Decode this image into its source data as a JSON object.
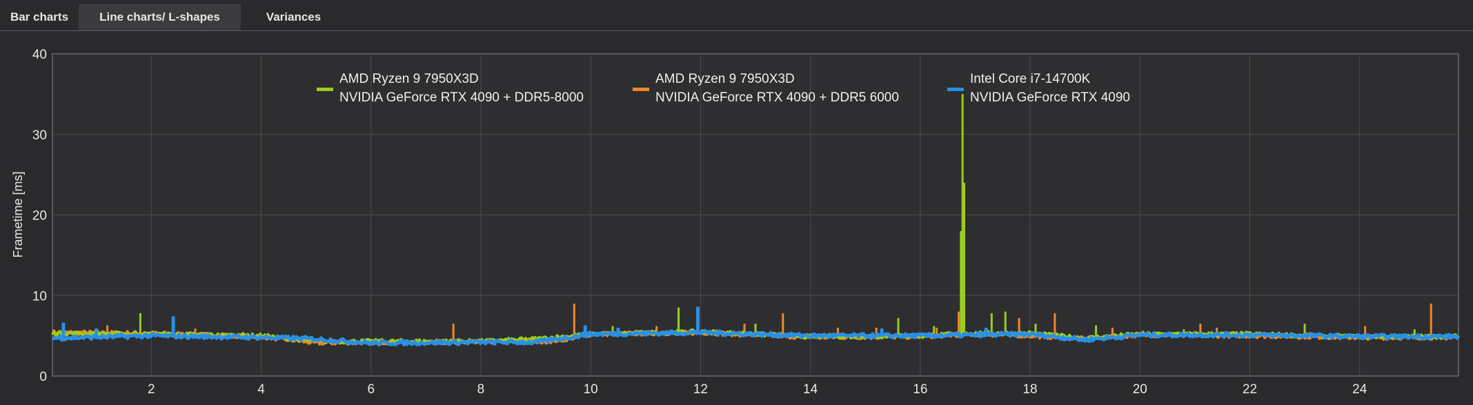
{
  "tabs": [
    {
      "label": "Bar charts"
    },
    {
      "label": "Line charts/ L-shapes"
    },
    {
      "label": "Variances"
    }
  ],
  "chart_data": {
    "type": "line",
    "title": "",
    "xlabel": "",
    "ylabel": "Frametime [ms]",
    "xlim": [
      0.2,
      25.8
    ],
    "ylim": [
      0,
      40
    ],
    "x_ticks": [
      2,
      4,
      6,
      8,
      10,
      12,
      14,
      16,
      18,
      20,
      22,
      24
    ],
    "y_ticks": [
      0,
      10,
      20,
      30,
      40
    ],
    "grid": true,
    "legend_position": "top",
    "series": [
      {
        "name_line1": "AMD Ryzen 9 7950X3D",
        "name_line2": "NVIDIA GeForce RTX 4090 + DDR5-8000",
        "color": "#9acd1e",
        "baseline": [
          [
            0.2,
            5.3
          ],
          [
            2,
            5.2
          ],
          [
            4,
            5.0
          ],
          [
            5,
            4.3
          ],
          [
            6,
            4.3
          ],
          [
            8,
            4.3
          ],
          [
            9,
            4.6
          ],
          [
            10,
            5.2
          ],
          [
            12,
            5.5
          ],
          [
            14,
            4.9
          ],
          [
            16,
            5.0
          ],
          [
            17,
            5.3
          ],
          [
            18,
            5.3
          ],
          [
            19,
            4.7
          ],
          [
            20,
            5.2
          ],
          [
            22,
            5.2
          ],
          [
            24,
            4.9
          ],
          [
            25.8,
            4.9
          ]
        ],
        "spikes": [
          [
            1.8,
            7.8
          ],
          [
            10.4,
            6.2
          ],
          [
            11.6,
            8.5
          ],
          [
            13.0,
            6.5
          ],
          [
            15.6,
            7.2
          ],
          [
            16.25,
            6.2
          ],
          [
            16.74,
            18.0
          ],
          [
            16.77,
            35.0
          ],
          [
            16.8,
            24.0
          ],
          [
            17.3,
            7.8
          ],
          [
            17.55,
            8.0
          ],
          [
            18.1,
            6.5
          ],
          [
            19.2,
            6.3
          ],
          [
            20.8,
            5.8
          ],
          [
            23.0,
            6.5
          ],
          [
            25.0,
            5.8
          ]
        ]
      },
      {
        "name_line1": "AMD Ryzen 9 7950X3D",
        "name_line2": "NVIDIA GeForce RTX 4090 + DDR5 6000",
        "color": "#f08828",
        "baseline": [
          [
            0.2,
            5.4
          ],
          [
            2,
            5.3
          ],
          [
            4,
            4.9
          ],
          [
            5,
            4.1
          ],
          [
            6,
            4.2
          ],
          [
            8,
            4.3
          ],
          [
            9,
            4.2
          ],
          [
            9.5,
            4.5
          ],
          [
            10,
            5.2
          ],
          [
            12,
            5.4
          ],
          [
            14,
            4.8
          ],
          [
            16,
            4.9
          ],
          [
            17,
            5.2
          ],
          [
            18,
            5.0
          ],
          [
            19,
            4.6
          ],
          [
            20,
            5.1
          ],
          [
            22,
            5.0
          ],
          [
            24,
            4.8
          ],
          [
            25.8,
            4.8
          ]
        ],
        "spikes": [
          [
            1.2,
            6.3
          ],
          [
            2.8,
            5.9
          ],
          [
            7.5,
            6.5
          ],
          [
            9.7,
            9.0
          ],
          [
            11.2,
            6.2
          ],
          [
            12.8,
            6.5
          ],
          [
            13.5,
            7.8
          ],
          [
            14.5,
            6.0
          ],
          [
            15.2,
            6.0
          ],
          [
            16.3,
            6.0
          ],
          [
            16.7,
            8.0
          ],
          [
            17.8,
            7.2
          ],
          [
            18.45,
            7.8
          ],
          [
            19.5,
            6.0
          ],
          [
            21.1,
            6.5
          ],
          [
            21.4,
            6.0
          ],
          [
            24.1,
            6.2
          ],
          [
            25.3,
            9.0
          ]
        ]
      },
      {
        "name_line1": "Intel Core i7-14700K",
        "name_line2": "NVIDIA GeForce RTX 4090",
        "color": "#2a90e6",
        "baseline": [
          [
            0.2,
            4.7
          ],
          [
            2,
            5.0
          ],
          [
            4,
            4.8
          ],
          [
            5,
            4.6
          ],
          [
            6,
            4.1
          ],
          [
            8,
            4.2
          ],
          [
            9,
            4.2
          ],
          [
            10,
            5.2
          ],
          [
            12,
            5.4
          ],
          [
            14,
            5.0
          ],
          [
            16,
            5.0
          ],
          [
            17,
            5.1
          ],
          [
            18,
            5.2
          ],
          [
            19,
            4.5
          ],
          [
            20,
            5.1
          ],
          [
            22,
            5.1
          ],
          [
            24,
            4.9
          ],
          [
            25.8,
            4.9
          ]
        ],
        "spikes": [
          [
            0.4,
            6.6
          ],
          [
            1.0,
            5.9
          ],
          [
            2.4,
            7.4
          ],
          [
            9.9,
            6.3
          ],
          [
            10.5,
            6.0
          ],
          [
            11.95,
            8.6
          ],
          [
            15.3,
            5.9
          ],
          [
            17.2,
            6.0
          ]
        ]
      }
    ]
  }
}
